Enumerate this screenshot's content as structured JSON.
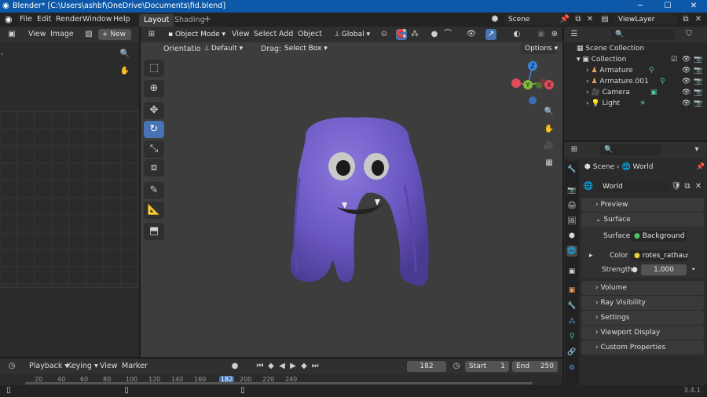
{
  "window": {
    "title": "Blender* [C:\\Users\\ashbf\\OneDrive\\Documents\\fid.blend]",
    "min": "─",
    "max": "☐",
    "close": "✕"
  },
  "menu": {
    "items": [
      "File",
      "Edit",
      "Render",
      "Window",
      "Help"
    ],
    "tabs": [
      "Layout",
      "Shading"
    ],
    "add_tab": "+",
    "scene": "Scene",
    "viewlayer": "ViewLayer"
  },
  "image_editor": {
    "view": "View",
    "image": "Image",
    "new": "New"
  },
  "viewport": {
    "mode": "Object Mode",
    "menus": [
      "View",
      "Select",
      "Add",
      "Object"
    ],
    "transform": "Global",
    "orientation_label": "Orientation:",
    "orientation": "Default",
    "drag_label": "Drag:",
    "drag": "Select Box",
    "options": "Options",
    "gizmo": {
      "x": "X",
      "y": "Y",
      "z": "Z"
    }
  },
  "outliner": {
    "root": "Scene Collection",
    "collection": "Collection",
    "items": [
      "Armature",
      "Armature.001",
      "Camera",
      "Light"
    ]
  },
  "properties": {
    "breadcrumb_scene": "Scene",
    "breadcrumb_world": "World",
    "world_name": "World",
    "sections": {
      "preview": "Preview",
      "surface": "Surface",
      "volume": "Volume",
      "ray": "Ray Visibility",
      "settings": "Settings",
      "viewport_display": "Viewport Display",
      "custom": "Custom Properties"
    },
    "surface_label": "Surface",
    "surface_value": "Background",
    "color_label": "Color",
    "color_value": "rotes_rathaus_...",
    "strength_label": "Strength",
    "strength_value": "1.000"
  },
  "timeline": {
    "menus": [
      "Playback",
      "Keying",
      "View",
      "Marker"
    ],
    "current_frame": "182",
    "start_label": "Start",
    "start": "1",
    "end_label": "End",
    "end": "250",
    "ticks": [
      "20",
      "40",
      "60",
      "80",
      "100",
      "120",
      "140",
      "160",
      "182",
      "200",
      "220",
      "240"
    ]
  },
  "status": {
    "version": "3.4.1"
  },
  "colors": {
    "accent": "#4772b3",
    "monster": "#6a56c0",
    "titlebar": "#0d58a8"
  }
}
